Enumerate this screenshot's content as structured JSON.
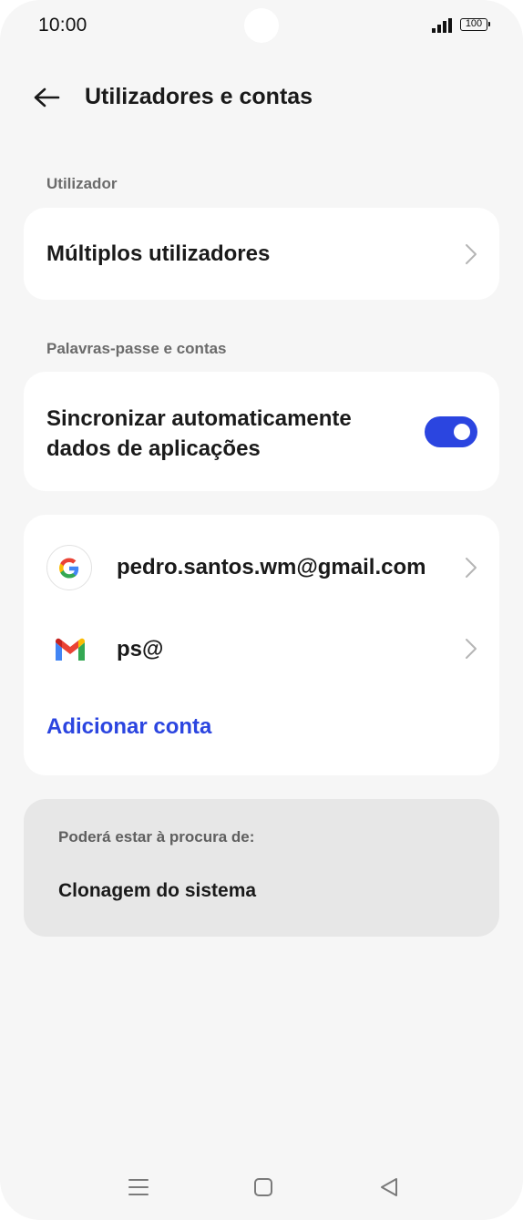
{
  "status_bar": {
    "time": "10:00",
    "battery": "100",
    "signal_icon": "signal-bars-icon",
    "battery_icon": "battery-icon"
  },
  "header": {
    "back_icon": "arrow-left-icon",
    "title": "Utilizadores e contas"
  },
  "sections": {
    "user_label": "Utilizador",
    "multiple_users": "Múltiplos utilizadores",
    "passwords_label": "Palavras-passe e contas",
    "auto_sync": "Sincronizar automaticamente dados de aplicações",
    "auto_sync_on": true
  },
  "accounts": {
    "items": [
      {
        "icon": "google-icon",
        "label": "pedro.santos.wm@gmail.com"
      },
      {
        "icon": "gmail-icon",
        "label": "ps@"
      }
    ],
    "add_label": "Adicionar conta"
  },
  "suggestions": {
    "label": "Poderá estar à procura de:",
    "item": "Clonagem do sistema"
  },
  "navbar": {
    "menu_icon": "menu-icon",
    "home_icon": "home-icon",
    "back_icon": "back-triangle-icon"
  },
  "colors": {
    "accent": "#2b45e0",
    "background": "#f6f6f6",
    "card": "#ffffff",
    "suggest_card": "#e7e7e7"
  }
}
